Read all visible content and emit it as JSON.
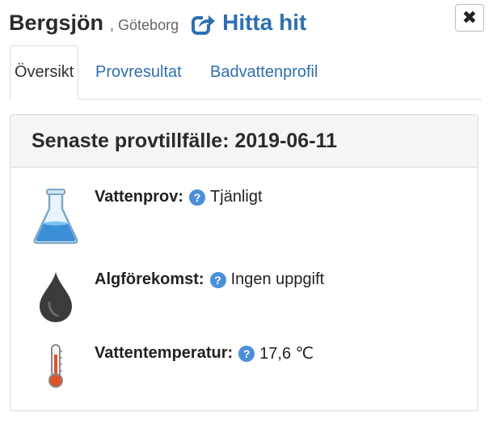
{
  "header": {
    "title": "Bergsjön",
    "subtitle": ", Göteborg",
    "directions_label": "Hitta hit",
    "close_label": "✖"
  },
  "tabs": [
    {
      "label": "Översikt",
      "active": true
    },
    {
      "label": "Provresultat",
      "active": false
    },
    {
      "label": "Badvattenprofil",
      "active": false
    }
  ],
  "panel": {
    "heading": "Senaste provtillfälle: 2019-06-11",
    "rows": [
      {
        "icon": "flask-icon",
        "label": "Vattenprov:",
        "help": "?",
        "value": "Tjänligt"
      },
      {
        "icon": "oil-drop-icon",
        "label": "Algförekomst:",
        "help": "?",
        "value": "Ingen uppgift"
      },
      {
        "icon": "thermometer-icon",
        "label": "Vattentemperatur:",
        "help": "?",
        "value": "17,6 ℃"
      }
    ]
  },
  "colors": {
    "link": "#2f6fb0",
    "help": "#4a8fd8",
    "flask_liquid": "#3b8fd6",
    "thermometer": "#e0522a"
  }
}
